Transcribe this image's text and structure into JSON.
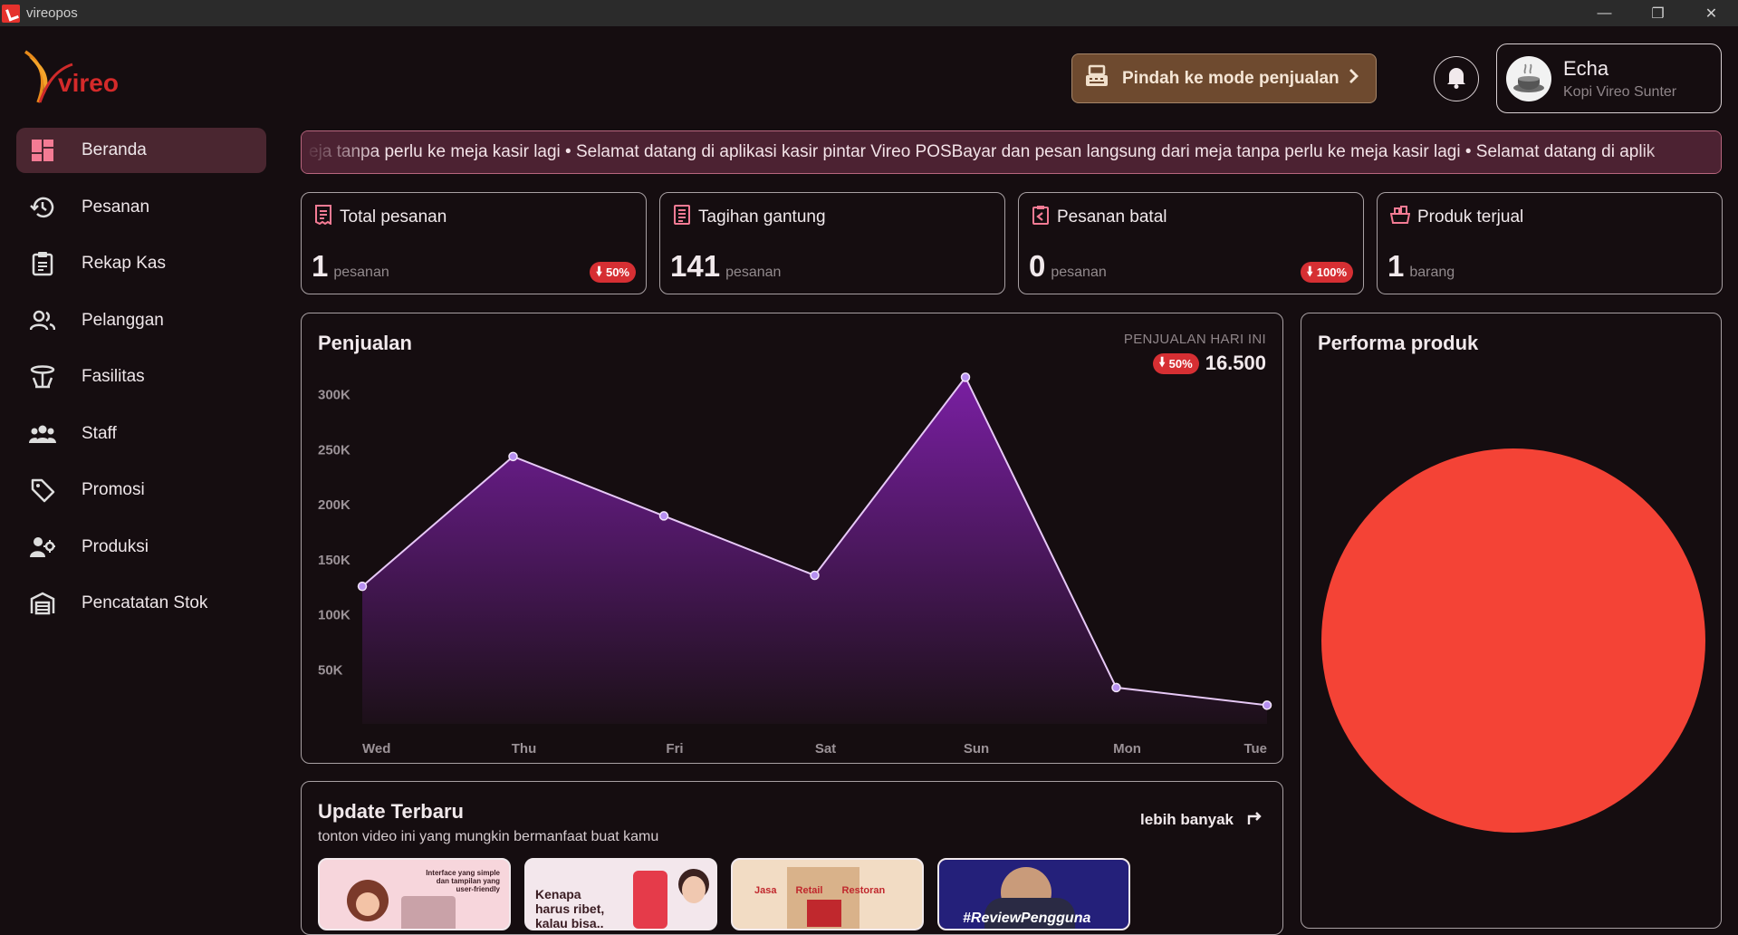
{
  "window": {
    "title": "vireopos"
  },
  "sidebar": {
    "logo_text": "vireo",
    "items": [
      {
        "label": "Beranda",
        "icon": "dashboard-icon",
        "active": true
      },
      {
        "label": "Pesanan",
        "icon": "history-icon"
      },
      {
        "label": "Rekap Kas",
        "icon": "clipboard-icon"
      },
      {
        "label": "Pelanggan",
        "icon": "users-icon"
      },
      {
        "label": "Fasilitas",
        "icon": "table-icon"
      },
      {
        "label": "Staff",
        "icon": "staff-icon"
      },
      {
        "label": "Promosi",
        "icon": "tag-icon"
      },
      {
        "label": "Produksi",
        "icon": "production-icon"
      },
      {
        "label": "Pencatatan Stok",
        "icon": "warehouse-icon"
      }
    ]
  },
  "header": {
    "mode_button": "Pindah ke mode penjualan",
    "user": {
      "name": "Echa",
      "store": "Kopi Vireo Sunter"
    }
  },
  "marquee": {
    "text": "eja tanpa perlu ke meja kasir lagi  •  Selamat datang di aplikasi kasir pintar Vireo POSBayar dan pesan langsung dari meja tanpa perlu ke meja kasir lagi  •  Selamat datang di aplik"
  },
  "stats": [
    {
      "title": "Total pesanan",
      "value": "1",
      "unit": "pesanan",
      "badge": "50%",
      "icon": "receipt-icon"
    },
    {
      "title": "Tagihan gantung",
      "value": "141",
      "unit": "pesanan",
      "badge": null,
      "icon": "bill-icon"
    },
    {
      "title": "Pesanan batal",
      "value": "0",
      "unit": "pesanan",
      "badge": "100%",
      "icon": "cancel-order-icon"
    },
    {
      "title": "Produk terjual",
      "value": "1",
      "unit": "barang",
      "badge": null,
      "icon": "product-icon"
    }
  ],
  "sales": {
    "title": "Penjualan",
    "today_label": "PENJUALAN HARI INI",
    "today_badge": "50%",
    "today_value": "16.500"
  },
  "chart_data": {
    "type": "area",
    "title": "Penjualan",
    "categories": [
      "Wed",
      "Thu",
      "Fri",
      "Sat",
      "Sun",
      "Mon",
      "Tue"
    ],
    "values": [
      125000,
      243000,
      189000,
      135000,
      315000,
      33000,
      17000
    ],
    "ylim": [
      0,
      340000
    ],
    "yticks": [
      50000,
      100000,
      150000,
      200000,
      250000,
      300000
    ],
    "ytick_labels": [
      "50K",
      "100K",
      "150K",
      "200K",
      "250K",
      "300K"
    ],
    "colors": {
      "line": "#e7c9f7",
      "fill_top": "#7a1fa3",
      "fill_bottom": "#1c1018",
      "point": "#b68ff0"
    }
  },
  "performance": {
    "title": "Performa produk",
    "pie": {
      "type": "pie",
      "values": [
        1
      ],
      "colors": [
        "#f44336"
      ]
    }
  },
  "updates": {
    "title": "Update Terbaru",
    "subtitle": "tonton video ini yang mungkin bermanfaat buat kamu",
    "more": "lebih banyak",
    "thumbs": [
      {
        "text": "Interface yang simple dan tampilan yang user-friendly",
        "bg": "#f7d6dc"
      },
      {
        "text": "Kenapa harus ribet, kalau bisa..",
        "bg": "#f3e7ec"
      },
      {
        "text": "Jasa  Retail  Restoran",
        "bg": "#f2dcc4"
      },
      {
        "text": "#ReviewPengguna",
        "bg": "#24207a"
      }
    ]
  }
}
